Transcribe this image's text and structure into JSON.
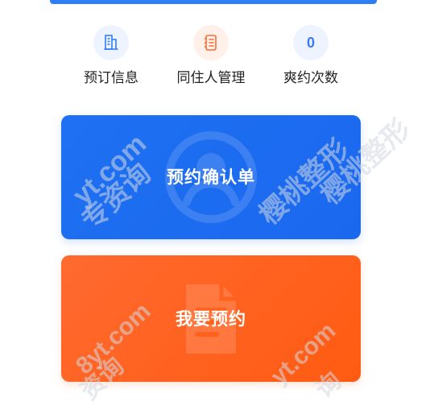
{
  "quick_actions": [
    {
      "label": "预订信息",
      "icon": "building-icon"
    },
    {
      "label": "同住人管理",
      "icon": "notebook-icon"
    },
    {
      "count": "0",
      "label": "爽约次数"
    }
  ],
  "actions": {
    "confirm_label": "预约确认单",
    "booking_label": "我要预约"
  },
  "watermarks": {
    "site": "yt.com",
    "consult_a": "专资询",
    "brand": "樱桃整形",
    "domain_prefix": "8yt.com",
    "consult_b": "资询",
    "site_b": "yt.com",
    "consult_c": "询"
  },
  "colors": {
    "primary_blue": "#1f70f2",
    "primary_orange": "#ff5f1a",
    "count_blue": "#3a7af2"
  }
}
